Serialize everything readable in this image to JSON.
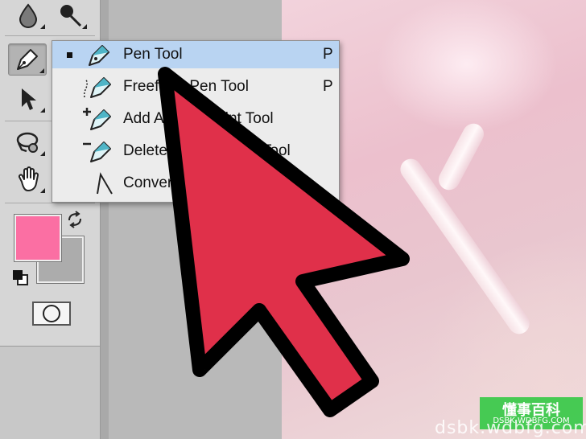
{
  "toolbox": {
    "tools": [
      {
        "name": "blur-tool",
        "icon": "drop-icon"
      },
      {
        "name": "dodge-tool",
        "icon": "dodge-icon"
      },
      {
        "name": "pen-tool",
        "icon": "pen-icon",
        "active": true
      },
      {
        "name": "path-selection-tool",
        "icon": "arrow-icon"
      },
      {
        "name": "rotate-view-tool",
        "icon": "rotate-icon"
      },
      {
        "name": "hand-tool",
        "icon": "hand-icon"
      }
    ],
    "colors": {
      "foreground": "#fb6fa3",
      "background": "#acacac"
    },
    "quick_mask_icon": "quick-mask-icon"
  },
  "pen_menu": {
    "items": [
      {
        "label": "Pen Tool",
        "shortcut": "P",
        "selected": true,
        "icon": "pen-icon"
      },
      {
        "label": "Freeform Pen Tool",
        "shortcut": "P",
        "selected": false,
        "icon": "freeform-pen-icon"
      },
      {
        "label": "Add Anchor Point Tool",
        "shortcut": "",
        "selected": false,
        "icon": "add-anchor-icon"
      },
      {
        "label": "Delete Anchor Point Tool",
        "shortcut": "",
        "selected": false,
        "icon": "delete-anchor-icon"
      },
      {
        "label": "Convert Point Tool",
        "shortcut": "",
        "selected": false,
        "icon": "convert-point-icon"
      }
    ],
    "highlight_color": "#b9d4f2"
  },
  "cursor": {
    "icon": "big-arrow-cursor-icon",
    "fill": "#e0304a",
    "outline": "#000000"
  },
  "watermark": {
    "title": "懂事百科",
    "subtitle": "DSBK.WDBFG.COM",
    "url": "dsbk.wdbfg.com"
  }
}
